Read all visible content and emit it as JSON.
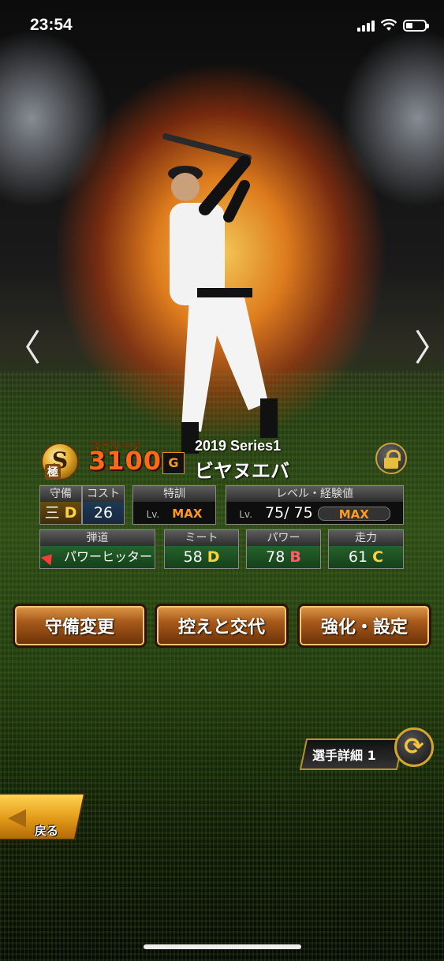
{
  "status_bar": {
    "time": "23:54"
  },
  "card": {
    "rarity": "S",
    "rarity_sub": "極",
    "spirits_label": "スピリッツ",
    "spirits_value": "3100",
    "team_icon": "giants-logo-icon",
    "series": "2019 Series1",
    "player_name": "ビヤヌエバ"
  },
  "stats": {
    "defense": {
      "header": "守備",
      "position": "三",
      "grade": "D"
    },
    "cost": {
      "header": "コスト",
      "value": "26"
    },
    "training": {
      "header": "特訓",
      "lv": "Lv.",
      "value": "MAX"
    },
    "level": {
      "header": "レベル・経験値",
      "lv": "Lv.",
      "value": "75/ 75",
      "exp": "MAX"
    },
    "trajectory": {
      "header": "弾道",
      "value": "パワーヒッター"
    },
    "meet": {
      "header": "ミート",
      "value": "58",
      "grade": "D"
    },
    "power": {
      "header": "パワー",
      "value": "78",
      "grade": "B"
    },
    "speed": {
      "header": "走力",
      "value": "61",
      "grade": "C"
    }
  },
  "buttons": {
    "defense_change": "守備変更",
    "swap_bench": "控えと交代",
    "enhance_settings": "強化・設定"
  },
  "detail": {
    "label": "選手詳細 1"
  },
  "back": {
    "label": "戻る"
  },
  "nav": {
    "prev": "〈",
    "next": "〉"
  }
}
